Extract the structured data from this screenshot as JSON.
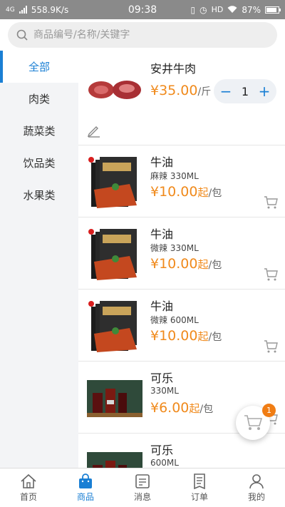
{
  "status_bar": {
    "network": "4G",
    "speed": "558.9K/s",
    "time": "09:38",
    "hd": "HD",
    "battery": "87%"
  },
  "search": {
    "placeholder": "商品编号/名称/关键字"
  },
  "sidebar": {
    "items": [
      {
        "label": "全部",
        "active": true
      },
      {
        "label": "肉类"
      },
      {
        "label": "蔬菜类"
      },
      {
        "label": "饮品类"
      },
      {
        "label": "水果类"
      }
    ]
  },
  "featured": {
    "name": "安井牛肉",
    "price": "¥35.00",
    "unit": "/斤",
    "quantity": "1"
  },
  "products": [
    {
      "name": "牛油",
      "spec": "麻辣 330ML",
      "price": "¥10.00",
      "qi": "起",
      "unit": "/包"
    },
    {
      "name": "牛油",
      "spec": "微辣 330ML",
      "price": "¥10.00",
      "qi": "起",
      "unit": "/包"
    },
    {
      "name": "牛油",
      "spec": "微辣 600ML",
      "price": "¥10.00",
      "qi": "起",
      "unit": "/包"
    },
    {
      "name": "可乐",
      "spec": "330ML",
      "price": "¥6.00",
      "qi": "起",
      "unit": "/包"
    },
    {
      "name": "可乐",
      "spec": "600ML",
      "price": "",
      "qi": "",
      "unit": ""
    }
  ],
  "cart_badge": "1",
  "tabbar": {
    "items": [
      {
        "label": "首页",
        "icon": "home-icon"
      },
      {
        "label": "商品",
        "icon": "shopping-bag-icon",
        "active": true
      },
      {
        "label": "消息",
        "icon": "message-icon"
      },
      {
        "label": "订单",
        "icon": "order-icon"
      },
      {
        "label": "我的",
        "icon": "profile-icon"
      }
    ]
  },
  "colors": {
    "accent": "#1a7fd4",
    "price": "#f08a1c",
    "badge": "#f07d14"
  }
}
